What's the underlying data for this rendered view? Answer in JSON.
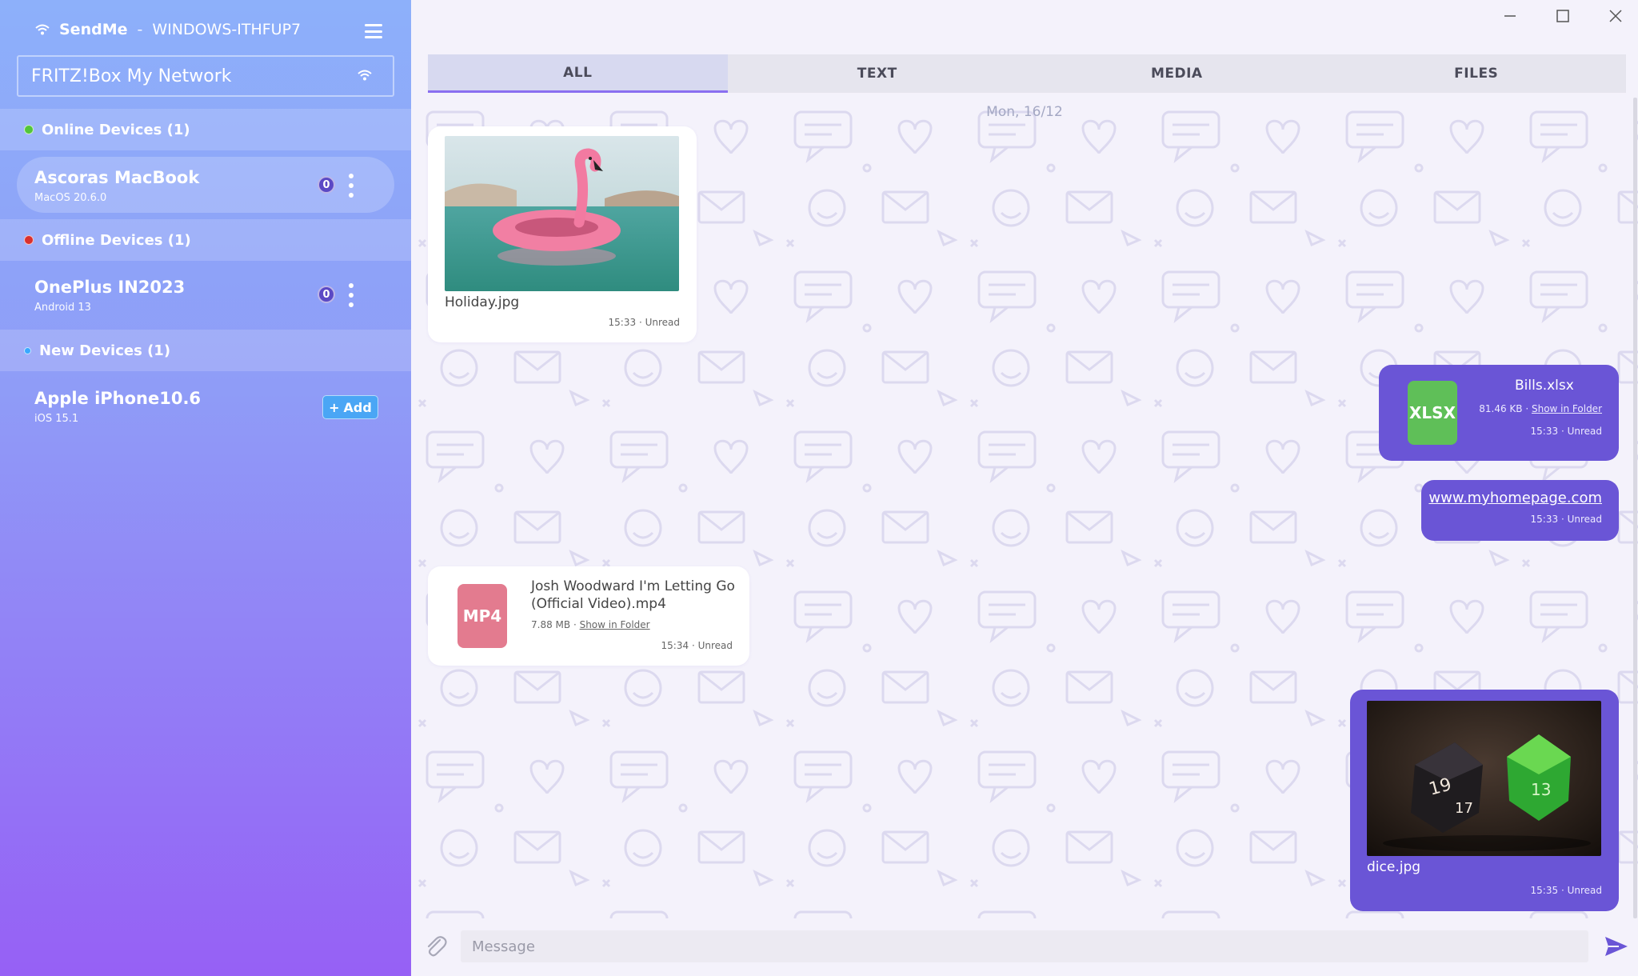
{
  "app": {
    "name": "SendMe",
    "separator": "-",
    "host": "WINDOWS-ITHFUP7"
  },
  "network": {
    "name": "FRITZ!Box My Network"
  },
  "sections": {
    "online": {
      "label": "Online Devices (1)",
      "status_color": "#53c53a"
    },
    "offline": {
      "label": "Offline Devices (1)",
      "status_color": "#d9302e"
    },
    "new": {
      "label": "New Devices (1)",
      "status_color": "#39a8ff"
    }
  },
  "devices": {
    "online": [
      {
        "name": "Ascoras MacBook",
        "os": "MacOS 20.6.0",
        "unread": "0"
      }
    ],
    "offline": [
      {
        "name": "OnePlus IN2023",
        "os": "Android 13",
        "unread": "0"
      }
    ],
    "new": [
      {
        "name": "Apple iPhone10.6",
        "os": "iOS 15.1",
        "add_label": "Add"
      }
    ]
  },
  "tabs": [
    {
      "label": "ALL",
      "active": true
    },
    {
      "label": "TEXT",
      "active": false
    },
    {
      "label": "MEDIA",
      "active": false
    },
    {
      "label": "FILES",
      "active": false
    }
  ],
  "chat": {
    "date": "Mon, 16/12",
    "messages": [
      {
        "direction": "in",
        "type": "image",
        "filename": "Holiday.jpg",
        "time": "15:33",
        "status": "Unread"
      },
      {
        "direction": "out",
        "type": "file",
        "icon": "XLSX",
        "icon_color": "#5fbf58",
        "filename": "Bills.xlsx",
        "size": "81.46 KB",
        "folder_link": "Show in Folder",
        "time": "15:33",
        "status": "Unread"
      },
      {
        "direction": "out",
        "type": "link",
        "url": "www.myhomepage.com",
        "time": "15:33",
        "status": "Unread"
      },
      {
        "direction": "in",
        "type": "file",
        "icon": "MP4",
        "icon_color": "#e37b8f",
        "filename_line1": "Josh Woodward I'm Letting Go",
        "filename_line2": "(Official Video).mp4",
        "size": "7.88 MB",
        "folder_link": "Show in Folder",
        "time": "15:34",
        "status": "Unread"
      },
      {
        "direction": "out",
        "type": "image",
        "filename": "dice.jpg",
        "time": "15:35",
        "status": "Unread"
      }
    ]
  },
  "composer": {
    "placeholder": "Message"
  },
  "colors": {
    "accent": "#6a55d6",
    "sidebar_top": "#8db0fa",
    "sidebar_bottom": "#9660f5"
  }
}
